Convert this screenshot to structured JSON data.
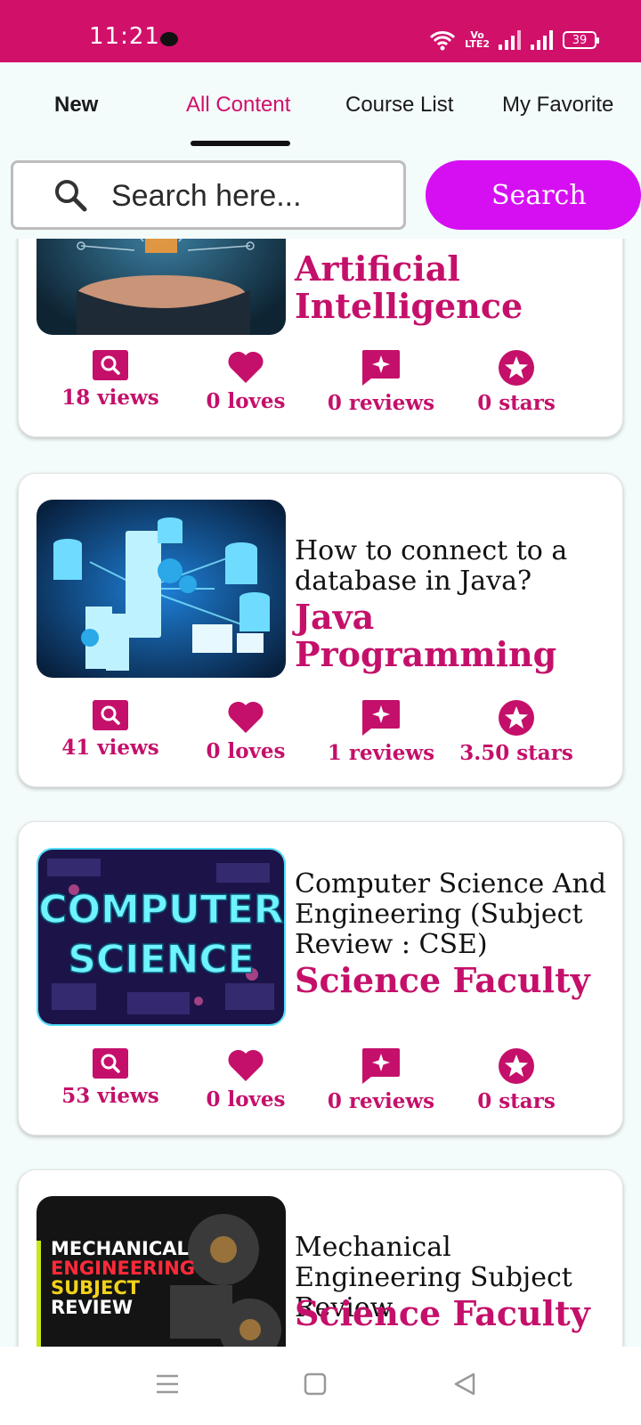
{
  "status_bar": {
    "time": "11:21",
    "volte_top": "Vo",
    "volte_bottom": "LTE2",
    "battery": "39",
    "color": "#d1106a"
  },
  "tabs": [
    {
      "label": "New",
      "active": false
    },
    {
      "label": "All Content",
      "active": true
    },
    {
      "label": "Course List",
      "active": false
    },
    {
      "label": "My Favorite",
      "active": false
    }
  ],
  "search": {
    "placeholder": "Search here...",
    "button_label": "Search",
    "button_color": "#d60ff2"
  },
  "cards": [
    {
      "title": "",
      "category": "Artificial Intelligence",
      "thumbnail": "ai-hand-circuit-image",
      "stats": {
        "views": "18 views",
        "loves": "0 loves",
        "reviews": "0 reviews",
        "stars": "0 stars"
      }
    },
    {
      "title": "How to connect to a database in Java?",
      "category": "Java Programming",
      "thumbnail": "database-servers-image",
      "stats": {
        "views": "41 views",
        "loves": "0 loves",
        "reviews": "1 reviews",
        "stars": "3.50 stars"
      }
    },
    {
      "title": "Computer Science And Engineering (Subject Review : CSE)",
      "category": "Science Faculty",
      "thumbnail": "computer-science-image",
      "thumbnail_text": [
        "COMPUTER",
        "SCIENCE"
      ],
      "stats": {
        "views": "53 views",
        "loves": "0 loves",
        "reviews": "0 reviews",
        "stars": "0 stars"
      }
    },
    {
      "title": "Mechanical Engineering Subject Review",
      "category": "Science Faculty",
      "thumbnail": "mechanical-engineering-image",
      "thumbnail_text": [
        "MECHANICAL",
        "ENGINEERING",
        "SUBJECT",
        "REVIEW"
      ],
      "stats": {}
    }
  ],
  "icons": {
    "views": "search-box-icon",
    "loves": "heart-icon",
    "reviews": "review-star-bubble-icon",
    "stars": "star-circle-icon",
    "accent": "#c4106a"
  },
  "nav": [
    "menu-icon",
    "home-square-icon",
    "back-triangle-icon"
  ]
}
